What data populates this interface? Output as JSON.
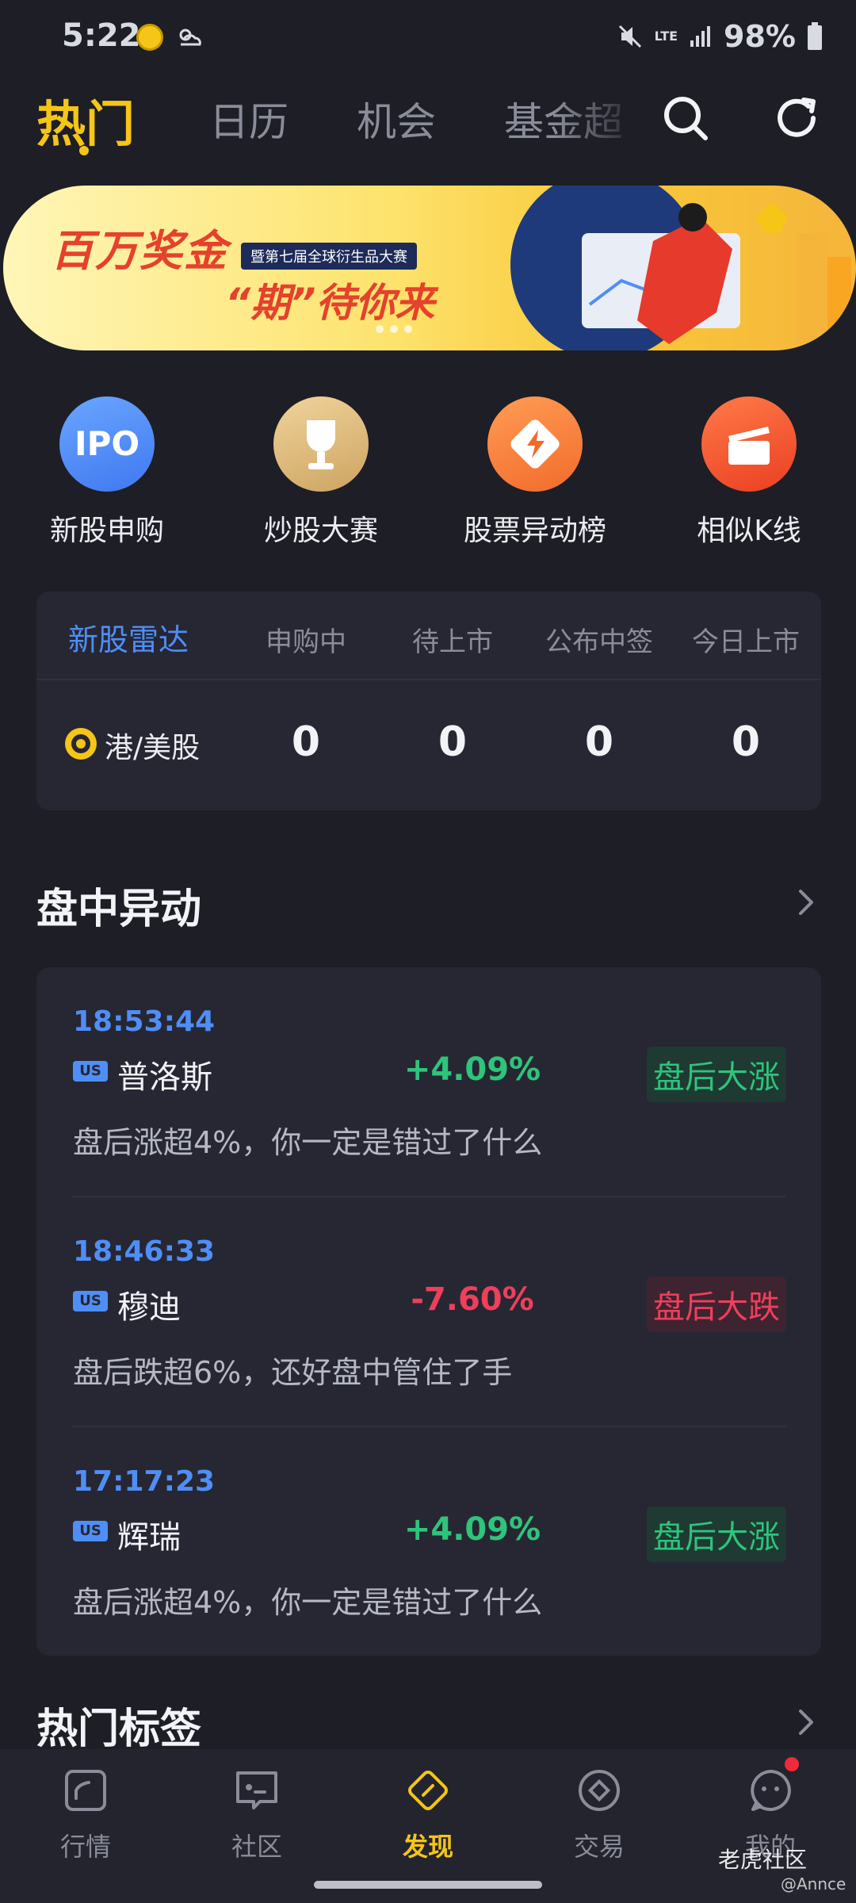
{
  "status_bar": {
    "time": "5:22",
    "network": "LTE",
    "battery": "98%"
  },
  "top_tabs": [
    {
      "label": "热门",
      "active": true
    },
    {
      "label": "日历",
      "active": false
    },
    {
      "label": "机会",
      "active": false
    },
    {
      "label": "基金超",
      "active": false
    }
  ],
  "banner": {
    "title": "百万奖金",
    "badge": "暨第七届全球衍生品大赛",
    "subtitle": "“期”待你来"
  },
  "features": [
    {
      "label": "新股申购",
      "icon": "ipo-icon",
      "color": "#4f8ef7"
    },
    {
      "label": "炒股大赛",
      "icon": "trophy-icon",
      "color": "#d9b778"
    },
    {
      "label": "股票异动榜",
      "icon": "lightning-icon",
      "color": "#f77a38"
    },
    {
      "label": "相似K线",
      "icon": "kline-icon",
      "color": "#f0522e"
    }
  ],
  "ipo_radar": {
    "title": "新股雷达",
    "columns": [
      "申购中",
      "待上市",
      "公布中签",
      "今日上市"
    ],
    "row_label": "港/美股",
    "values": [
      "0",
      "0",
      "0",
      "0"
    ]
  },
  "movers_section": {
    "title": "盘中异动",
    "items": [
      {
        "time": "18:53:44",
        "market": "US",
        "name": "普洛斯",
        "change": "+4.09%",
        "tag": "盘后大涨",
        "direction": "up",
        "desc": "盘后涨超4%，你一定是错过了什么"
      },
      {
        "time": "18:46:33",
        "market": "US",
        "name": "穆迪",
        "change": "-7.60%",
        "tag": "盘后大跌",
        "direction": "down",
        "desc": "盘后跌超6%，还好盘中管住了手"
      },
      {
        "time": "17:17:23",
        "market": "US",
        "name": "辉瑞",
        "change": "+4.09%",
        "tag": "盘后大涨",
        "direction": "up",
        "desc": "盘后涨超4%，你一定是错过了什么"
      }
    ]
  },
  "hot_tags_section": {
    "title": "热门标签"
  },
  "bottom_nav": [
    {
      "label": "行情",
      "icon": "chart-icon",
      "active": false
    },
    {
      "label": "社区",
      "icon": "community-icon",
      "active": false
    },
    {
      "label": "发现",
      "icon": "discover-icon",
      "active": true
    },
    {
      "label": "交易",
      "icon": "trade-icon",
      "active": false
    },
    {
      "label": "我的",
      "icon": "profile-icon",
      "active": false
    }
  ],
  "watermark": {
    "text": "老虎社区",
    "sub": "@Annce"
  },
  "colors": {
    "accent": "#f5c518",
    "blue": "#4f8ef7",
    "up": "#2ec47b",
    "down": "#ef3f5b",
    "background": "#1d1e26",
    "card": "#262733"
  }
}
